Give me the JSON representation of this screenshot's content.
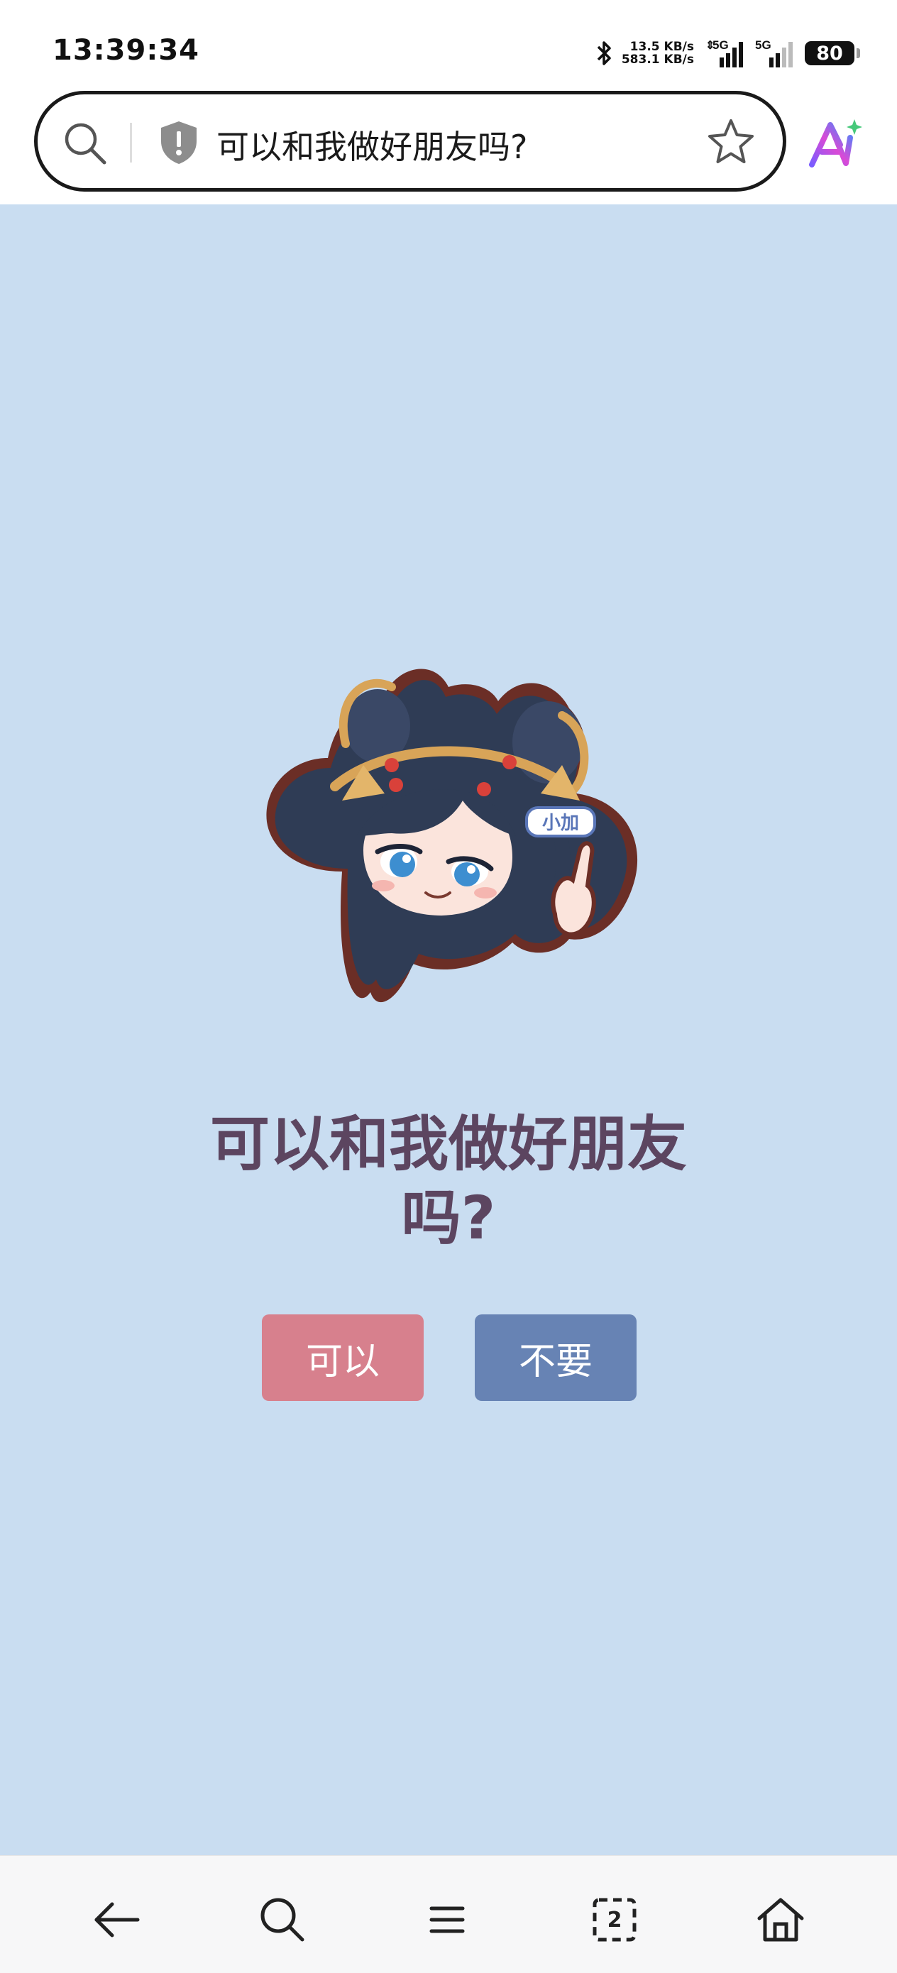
{
  "status_bar": {
    "time": "13:39:34",
    "upload_speed": "13.5 KB/s",
    "download_speed": "583.1 KB/s",
    "network_1": "5G",
    "network_2": "5G",
    "battery": "80",
    "icons": [
      "bluetooth-icon",
      "data-arrows-icon",
      "signal-icon",
      "signal-icon",
      "battery-icon"
    ]
  },
  "browser": {
    "address_text": "可以和我做好朋友吗?",
    "icons": [
      "search-icon",
      "shield-icon",
      "star-icon",
      "ai-assistant-icon"
    ]
  },
  "page": {
    "question": "可以和我做好朋友吗?",
    "yes_button": "可以",
    "no_button": "不要",
    "sticker_tag": "小加",
    "colors": {
      "background": "#c9ddf1",
      "yes": "#d7808d",
      "no": "#6783b4",
      "question": "#5c4560"
    }
  },
  "bottom_nav": {
    "tab_count": "2",
    "icons": [
      "back-arrow-icon",
      "search-icon",
      "menu-icon",
      "tabs-icon",
      "home-icon"
    ]
  }
}
